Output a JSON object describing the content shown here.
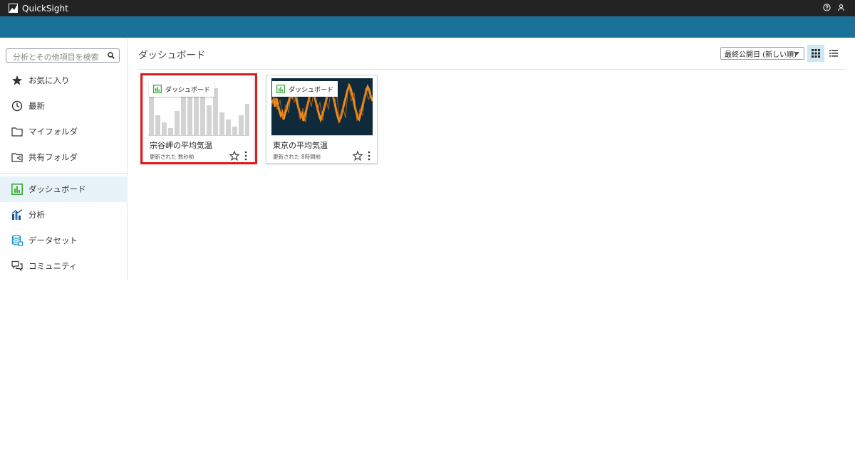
{
  "app": {
    "name": "QuickSight"
  },
  "search": {
    "placeholder": "分析とその他項目を検索"
  },
  "sidebar": {
    "items": [
      {
        "label": "お気に入り",
        "icon": "star-icon"
      },
      {
        "label": "最新",
        "icon": "clock-icon"
      },
      {
        "label": "マイフォルダ",
        "icon": "folder-icon"
      },
      {
        "label": "共有フォルダ",
        "icon": "shared-folder-icon"
      },
      {
        "label": "ダッシュボード",
        "icon": "dashboard-icon",
        "active": true
      },
      {
        "label": "分析",
        "icon": "analysis-icon"
      },
      {
        "label": "データセット",
        "icon": "dataset-icon"
      },
      {
        "label": "コミュニティ",
        "icon": "community-icon"
      }
    ]
  },
  "main": {
    "title": "ダッシュボード",
    "sort": {
      "selected": "最終公開日 (新しい順)"
    },
    "view_mode": "grid",
    "cards": [
      {
        "badge": "ダッシュボード",
        "title": "宗谷岬の平均気温",
        "updated_prefix": "更新された",
        "updated": "数秒前",
        "selected": true
      },
      {
        "badge": "ダッシュボード",
        "title": "東京の平均気温",
        "updated_prefix": "更新された",
        "updated": "8時間前",
        "selected": false
      }
    ]
  },
  "colors": {
    "topbar": "#232323",
    "banner": "#1a7299",
    "accent_green": "#3aaa35",
    "selection_red": "#e01b1b",
    "thumb2_bg": "#0e2a3b",
    "thumb2_line": "#f08a1c"
  }
}
